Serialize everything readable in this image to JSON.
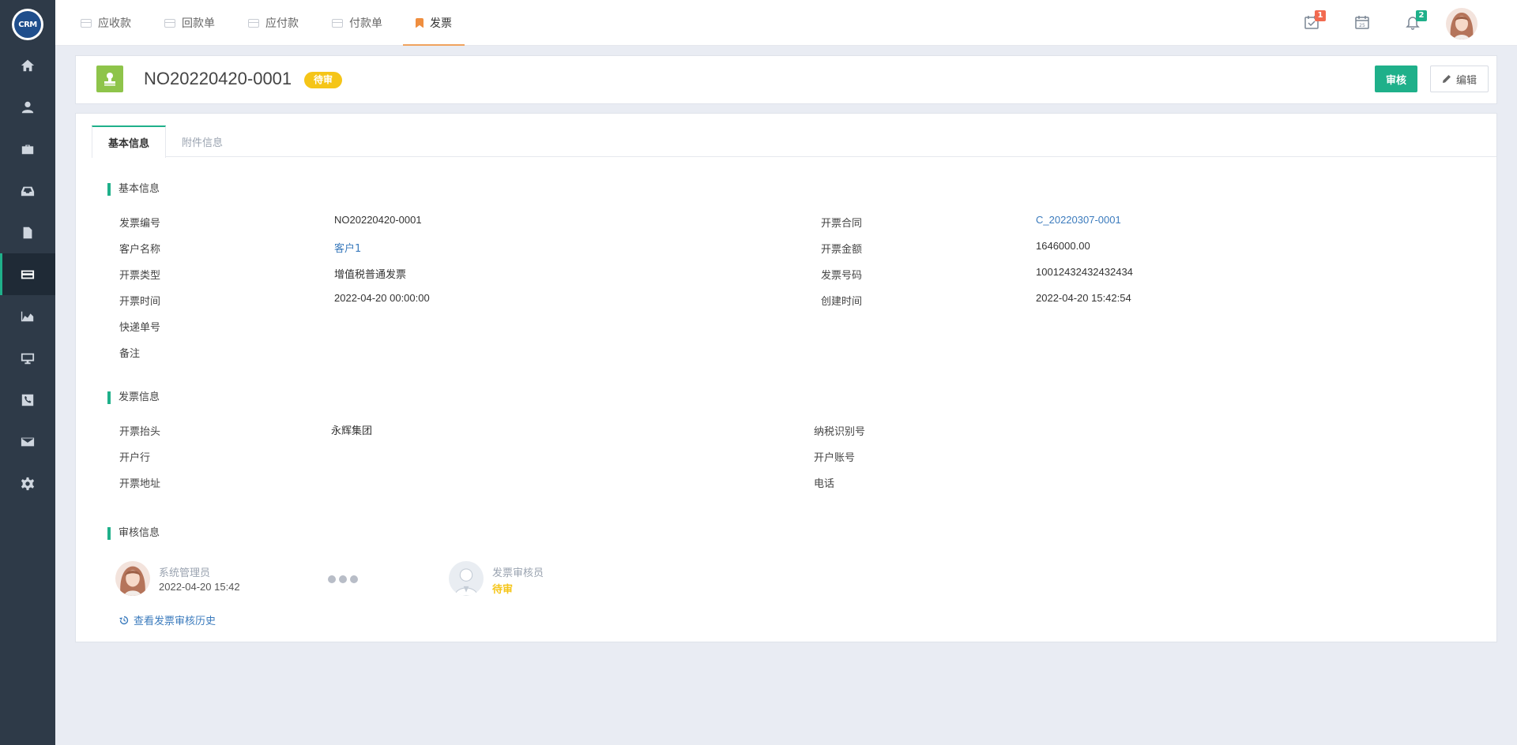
{
  "app": {
    "logo_text": "CRM"
  },
  "sidebar": {
    "items": [
      {
        "icon": "home-icon"
      },
      {
        "icon": "user-icon"
      },
      {
        "icon": "briefcase-icon"
      },
      {
        "icon": "inbox-icon"
      },
      {
        "icon": "document-icon"
      },
      {
        "icon": "credit-card-icon",
        "active": true
      },
      {
        "icon": "chart-icon"
      },
      {
        "icon": "monitor-icon"
      },
      {
        "icon": "phone-icon"
      },
      {
        "icon": "mail-icon"
      },
      {
        "icon": "gear-icon"
      }
    ]
  },
  "topbar": {
    "tabs": [
      {
        "label": "应收款"
      },
      {
        "label": "回款单"
      },
      {
        "label": "应付款"
      },
      {
        "label": "付款单"
      },
      {
        "label": "发票",
        "active": true
      }
    ],
    "task_badge": "1",
    "calendar_day": "25",
    "notification_badge": "2"
  },
  "header": {
    "doc_number": "NO20220420-0001",
    "status": "待审",
    "approve_label": "审核",
    "edit_label": "编辑"
  },
  "content_tabs": [
    {
      "label": "基本信息",
      "active": true
    },
    {
      "label": "附件信息"
    }
  ],
  "basic_info": {
    "title": "基本信息",
    "fields": {
      "invoice_no_label": "发票编号",
      "invoice_no": "NO20220420-0001",
      "customer_label": "客户名称",
      "customer": "客户1",
      "type_label": "开票类型",
      "type": "增值税普通发票",
      "date_label": "开票时间",
      "date": "2022-04-20 00:00:00",
      "express_label": "快递单号",
      "express": "",
      "remark_label": "备注",
      "remark": "",
      "contract_label": "开票合同",
      "contract": "C_20220307-0001",
      "amount_label": "开票金额",
      "amount": "1646000.00",
      "invoice_code_label": "发票号码",
      "invoice_code": "10012432432432434",
      "created_label": "创建时间",
      "created": "2022-04-20 15:42:54"
    }
  },
  "invoice_info": {
    "title": "发票信息",
    "fields": {
      "header_label": "开票抬头",
      "header": "永辉集团",
      "bank_label": "开户行",
      "bank": "",
      "address_label": "开票地址",
      "address": "",
      "tax_id_label": "纳税识别号",
      "tax_id": "",
      "account_label": "开户账号",
      "account": "",
      "phone_label": "电话",
      "phone": ""
    }
  },
  "approval_info": {
    "title": "审核信息",
    "submitter_name": "系统管理员",
    "submitter_time": "2022-04-20 15:42",
    "approver_name": "发票审核员",
    "approver_status": "待审",
    "history_link": "查看发票审核历史"
  },
  "colors": {
    "accent": "#1fb08a",
    "pending": "#f5c518",
    "link": "#3b7bbd",
    "sidebar": "#2e3a48",
    "active_tab": "#f0a35e"
  }
}
